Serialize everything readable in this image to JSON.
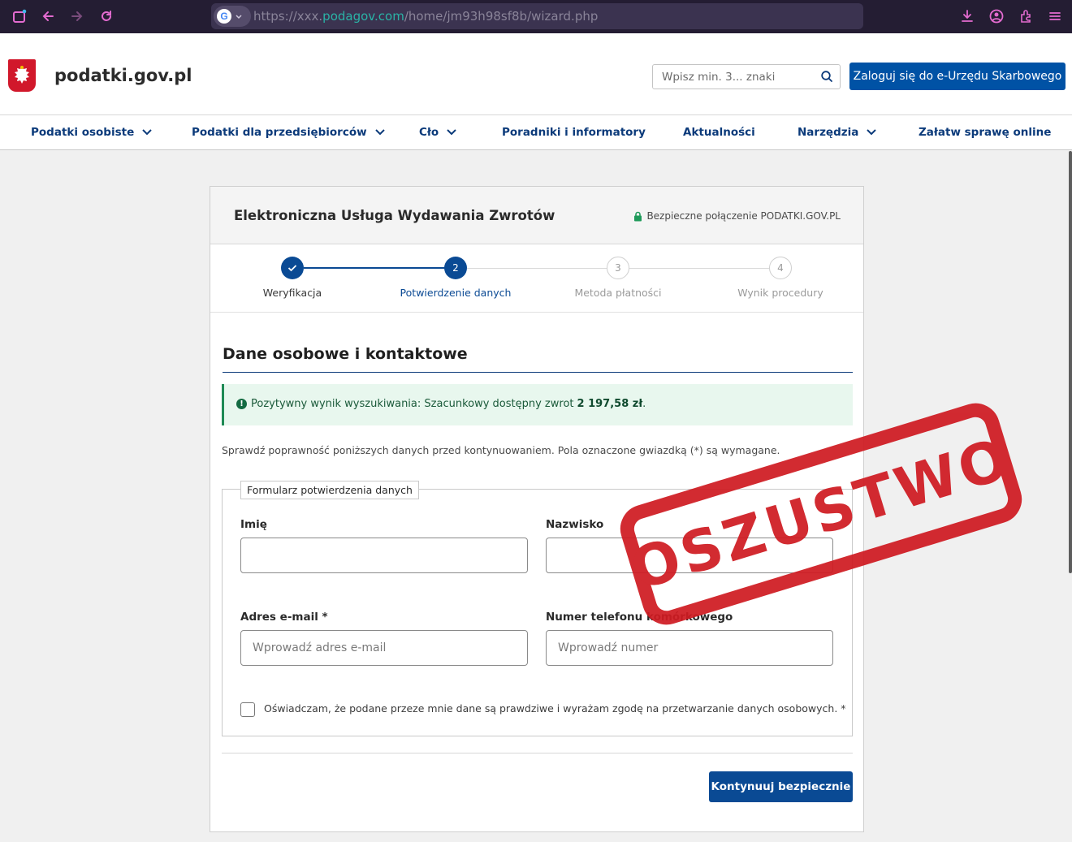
{
  "browser": {
    "url_prefix": "https://xxx.",
    "url_domain": "podagov.com",
    "url_path": "/home/jm93h98sf8b/wizard.php",
    "search_engine_letter": "G"
  },
  "header": {
    "site_title": "podatki.gov.pl",
    "search_placeholder": "Wpisz min. 3... znaki",
    "login_label": "Zaloguj się do e-Urzędu Skarbowego"
  },
  "nav": [
    {
      "label": "Podatki osobiste"
    },
    {
      "label": "Podatki dla przedsiębiorców"
    },
    {
      "label": "Cło"
    },
    {
      "label": "Poradniki i informatory"
    },
    {
      "label": "Aktualności"
    },
    {
      "label": "Narzędzia"
    },
    {
      "label": "Załatw sprawę online"
    }
  ],
  "card": {
    "title": "Elektroniczna Usługa Wydawania Zwrotów",
    "secure_label": "Bezpieczne połączenie PODATKI.GOV.PL",
    "steps": [
      {
        "num": "✓",
        "label": "Weryfikacja",
        "state": "done"
      },
      {
        "num": "2",
        "label": "Potwierdzenie danych",
        "state": "active"
      },
      {
        "num": "3",
        "label": "Metoda płatności",
        "state": "todo"
      },
      {
        "num": "4",
        "label": "Wynik procedury",
        "state": "todo"
      }
    ],
    "section_title": "Dane osobowe i kontaktowe",
    "alert_text": "Pozytywny wynik wyszukiwania: Szacunkowy dostępny zwrot",
    "alert_amount": "2 197,58 zł",
    "alert_end": ".",
    "intro": "Sprawdź poprawność poniższych danych przed kontynuowaniem. Pola oznaczone gwiazdką (*) są wymagane.",
    "form": {
      "legend": "Formularz potwierdzenia danych",
      "first_name_label": "Imię",
      "first_name_value": "",
      "last_name_label": "Nazwisko",
      "last_name_value": "",
      "email_label": "Adres e-mail *",
      "email_placeholder": "Wprowadź adres e-mail",
      "phone_label": "Numer telefonu komórkowego",
      "phone_placeholder": "Wprowadź numer",
      "consent_label": "Oświadczam, że podane przeze mnie dane są prawdziwe i wyrażam zgodę na przetwarzanie danych osobowych. *"
    },
    "continue_label": "Kontynuuj bezpiecznie"
  },
  "stamp_text": "OSZUSTWO",
  "colors": {
    "brand_blue": "#0a4a94",
    "stamp_red": "#cf1b22",
    "success_green": "#1f8a55"
  }
}
